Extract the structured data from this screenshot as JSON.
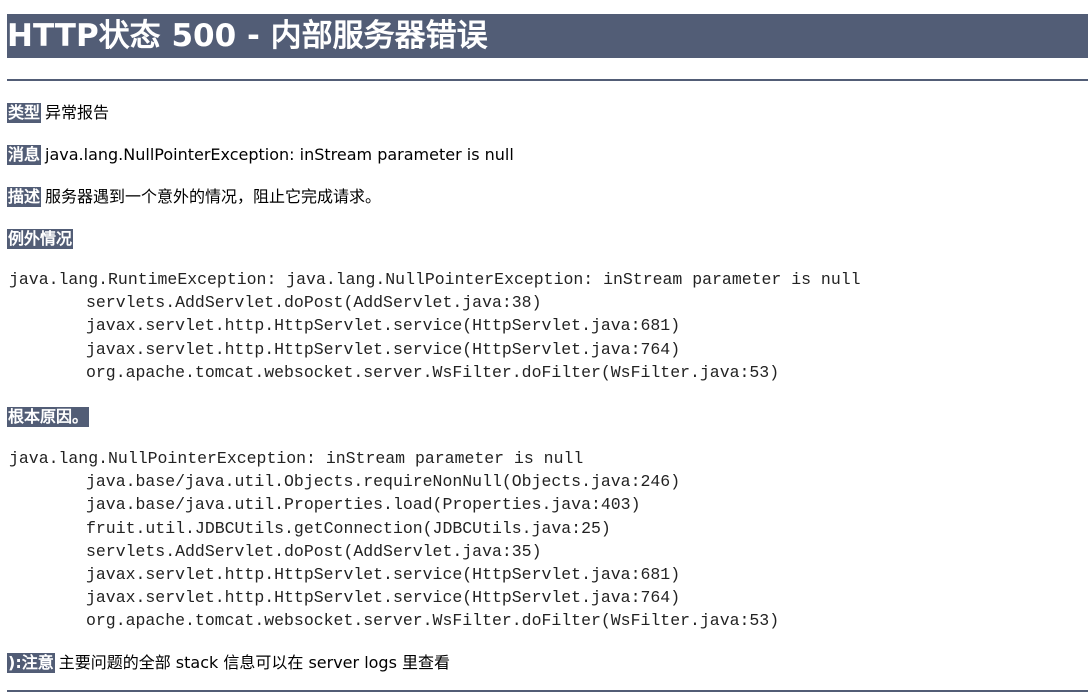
{
  "page_title": "HTTP状态 500 - 内部服务器错误",
  "type": {
    "label": "类型",
    "value": "异常报告"
  },
  "message": {
    "label": "消息",
    "value": "java.lang.NullPointerException: inStream parameter is null"
  },
  "description": {
    "label": "描述",
    "value": "服务器遇到一个意外的情况，阻止它完成请求。"
  },
  "exception": {
    "label": "例外情况",
    "lines": [
      "java.lang.RuntimeException: java.lang.NullPointerException: inStream parameter is null",
      "servlets.AddServlet.doPost(AddServlet.java:38)",
      "javax.servlet.http.HttpServlet.service(HttpServlet.java:681)",
      "javax.servlet.http.HttpServlet.service(HttpServlet.java:764)",
      "org.apache.tomcat.websocket.server.WsFilter.doFilter(WsFilter.java:53)"
    ]
  },
  "root_cause": {
    "label": "根本原因。",
    "lines": [
      "java.lang.NullPointerException: inStream parameter is null",
      "java.base/java.util.Objects.requireNonNull(Objects.java:246)",
      "java.base/java.util.Properties.load(Properties.java:403)",
      "fruit.util.JDBCUtils.getConnection(JDBCUtils.java:25)",
      "servlets.AddServlet.doPost(AddServlet.java:35)",
      "javax.servlet.http.HttpServlet.service(HttpServlet.java:681)",
      "javax.servlet.http.HttpServlet.service(HttpServlet.java:764)",
      "org.apache.tomcat.websocket.server.WsFilter.doFilter(WsFilter.java:53)"
    ]
  },
  "note": {
    "label": "):注意",
    "value": "主要问题的全部 stack 信息可以在 server logs 里查看"
  },
  "colors": {
    "header_bg": "#525d76",
    "header_text": "#ffffff",
    "body_text": "#000000"
  }
}
